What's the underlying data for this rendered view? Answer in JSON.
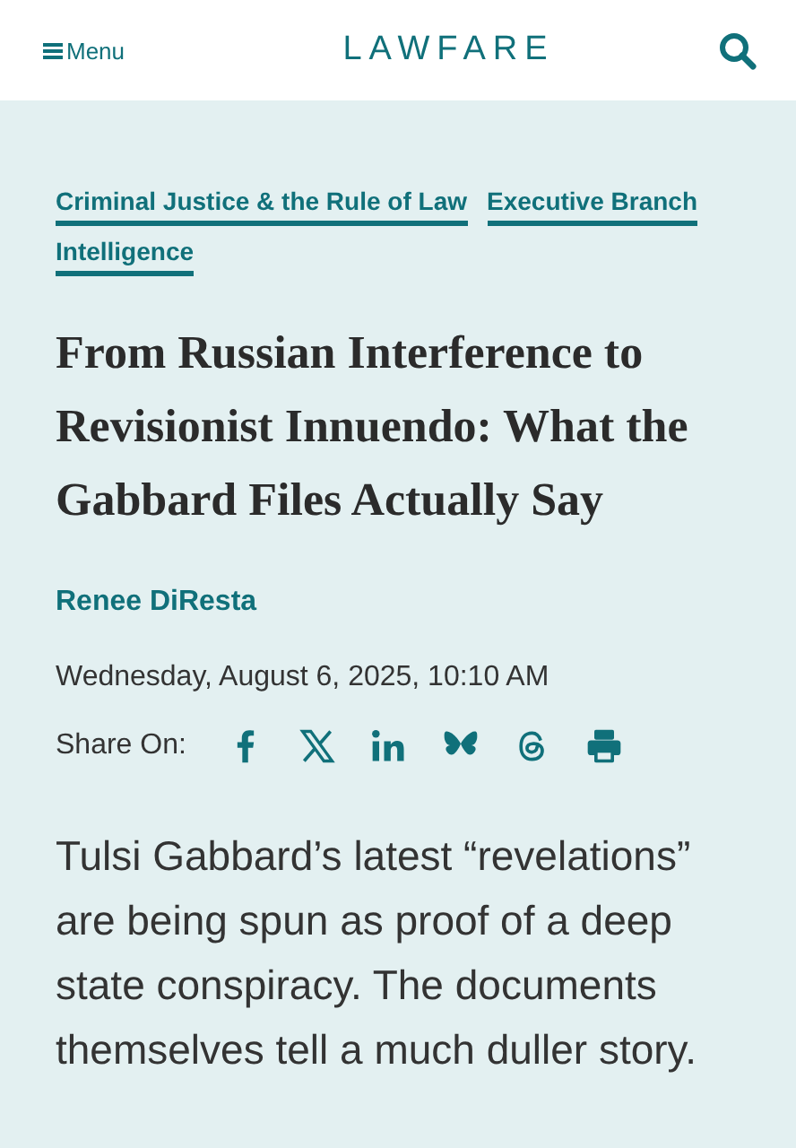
{
  "header": {
    "menu_label": "Menu",
    "logo": "LAWFARE"
  },
  "tags": [
    "Criminal Justice & the Rule of Law",
    "Executive Branch",
    "Intelligence"
  ],
  "title": "From Russian Interference to Revisionist Innuendo: What the Gabbard Files Actually Say",
  "author": "Renee DiResta",
  "date": "Wednesday, August 6, 2025, 10:10 AM",
  "share_label": "Share On:",
  "lede": "Tulsi Gabbard’s latest “revelations” are being spun as proof of a deep state conspiracy. The documents themselves tell a much duller story."
}
